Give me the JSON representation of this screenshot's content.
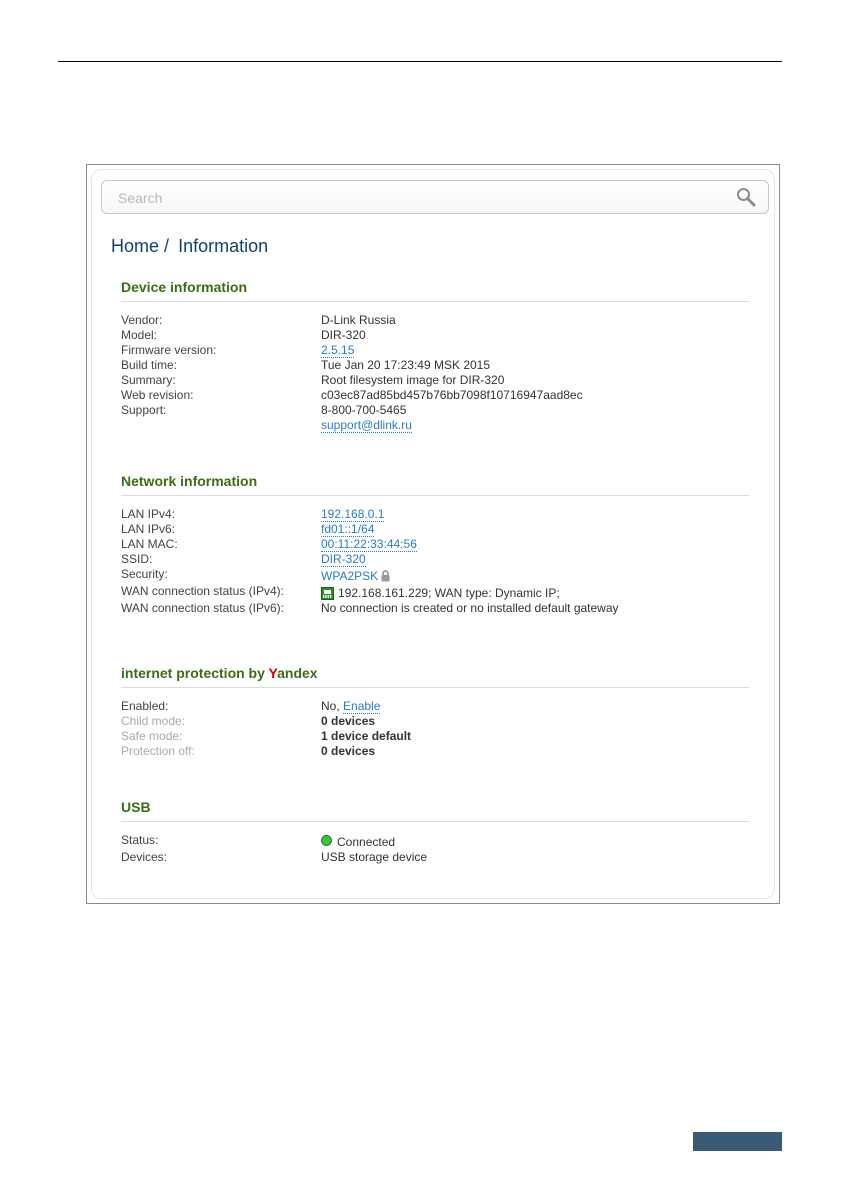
{
  "search": {
    "placeholder": "Search"
  },
  "breadcrumb": {
    "home": "Home",
    "separator": "/",
    "current": "Information"
  },
  "device": {
    "title": "Device information",
    "vendor_label": "Vendor:",
    "vendor": "D-Link Russia",
    "model_label": "Model:",
    "model": "DIR-320",
    "firmware_label": "Firmware version:",
    "firmware": "2.5.15",
    "build_label": "Build time:",
    "build": "Tue Jan 20 17:23:49 MSK 2015",
    "summary_label": "Summary:",
    "summary": "Root filesystem image for DIR-320",
    "webrev_label": "Web revision:",
    "webrev": "c03ec87ad85bd457b76bb7098f10716947aad8ec",
    "support_label": "Support:",
    "support_phone": "8-800-700-5465",
    "support_email": "support@dlink.ru"
  },
  "network": {
    "title": "Network information",
    "lan_ipv4_label": "LAN IPv4:",
    "lan_ipv4": "192.168.0.1",
    "lan_ipv6_label": "LAN IPv6:",
    "lan_ipv6": "fd01::1/64",
    "lan_mac_label": "LAN MAC:",
    "lan_mac": "00:11:22:33:44:56",
    "ssid_label": "SSID:",
    "ssid": "DIR-320",
    "security_label": "Security:",
    "security": "WPA2PSK",
    "wan4_label": "WAN connection status (IPv4):",
    "wan4": "192.168.161.229; WAN type: Dynamic IP;",
    "wan6_label": "WAN connection status (IPv6):",
    "wan6": "No connection is created or no installed default gateway"
  },
  "yandex": {
    "title_prefix": "internet protection by ",
    "title_y": "Y",
    "title_rest": "andex",
    "enabled_label": "Enabled:",
    "enabled_value": "No,",
    "enable_link": "Enable",
    "child_label": "Child mode:",
    "child": "0 devices",
    "safe_label": "Safe mode:",
    "safe": "1 device default",
    "off_label": "Protection off:",
    "off": "0 devices"
  },
  "usb": {
    "title": "USB",
    "status_label": "Status:",
    "status": "Connected",
    "devices_label": "Devices:",
    "devices": "USB storage device"
  },
  "colors": {
    "heading_blue": "#12406e",
    "section_green": "#3d6b1e",
    "link_blue": "#2a7bc4",
    "yandex_red": "#d40000",
    "status_green": "#3cc43c"
  }
}
